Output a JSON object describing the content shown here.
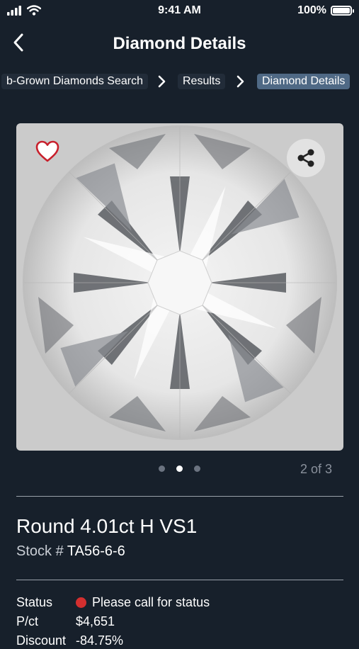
{
  "status_bar": {
    "time": "9:41 AM",
    "battery": "100%"
  },
  "header": {
    "title": "Diamond Details"
  },
  "breadcrumb": [
    {
      "label": "b-Grown Diamonds Search"
    },
    {
      "label": "Results"
    },
    {
      "label": "Diamond Details"
    }
  ],
  "gallery": {
    "counter": "2 of 3",
    "total": 3,
    "active_index": 1
  },
  "product": {
    "title": "Round 4.01ct H VS1",
    "stock_label": "Stock #",
    "stock_number": "TA56-6-6"
  },
  "details": [
    {
      "key": "Status",
      "value": "Please call for status",
      "indicator": "#d32f2f"
    },
    {
      "key": "P/ct",
      "value": "$4,651"
    },
    {
      "key": "Discount",
      "value": "-84.75%"
    }
  ],
  "colors": {
    "background": "#17202b",
    "accent_crumb": "#4f6985",
    "favorite": "#c8202c",
    "status_red": "#d32f2f"
  }
}
